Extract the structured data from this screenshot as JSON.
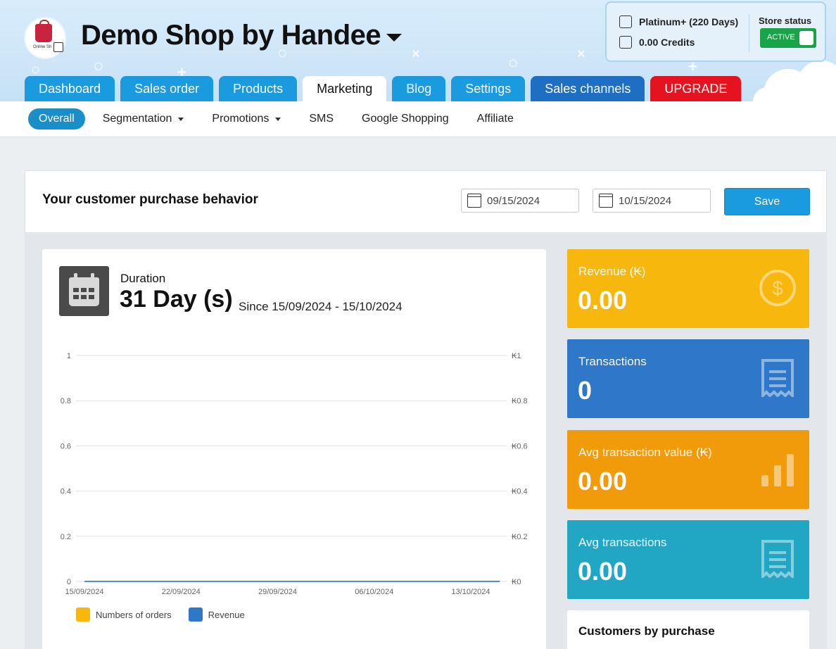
{
  "header": {
    "shop_name": "Demo Shop by Handee",
    "logo_text": "Online Sh",
    "plan_label": "Platinum+ (220 Days)",
    "credits_label": "0.00 Credits",
    "store_status_label": "Store status",
    "store_status_value": "ACTIVE",
    "status_color": "#19a44a"
  },
  "tabs": [
    {
      "label": "Dashboard",
      "active": false
    },
    {
      "label": "Sales order",
      "active": false
    },
    {
      "label": "Products",
      "active": false
    },
    {
      "label": "Marketing",
      "active": true
    },
    {
      "label": "Blog",
      "active": false
    },
    {
      "label": "Settings",
      "active": false
    },
    {
      "label": "Sales channels",
      "active": false
    },
    {
      "label": "UPGRADE",
      "active": false
    }
  ],
  "subnav": [
    {
      "label": "Overall",
      "active": true
    },
    {
      "label": "Segmentation",
      "dropdown": true
    },
    {
      "label": "Promotions",
      "dropdown": true
    },
    {
      "label": "SMS"
    },
    {
      "label": "Google Shopping"
    },
    {
      "label": "Affiliate"
    }
  ],
  "behavior": {
    "title": "Your customer purchase behavior",
    "start_date": "09/15/2024",
    "end_date": "10/15/2024",
    "save_label": "Save"
  },
  "duration": {
    "label": "Duration",
    "value": "31 Day (s)",
    "since": "Since 15/09/2024 - 15/10/2024"
  },
  "chart_data": {
    "type": "line",
    "x": [
      "15/09/2024",
      "22/09/2024",
      "29/09/2024",
      "06/10/2024",
      "13/10/2024"
    ],
    "y_left_ticks": [
      "0",
      "0.2",
      "0.4",
      "0.6",
      "0.8",
      "1"
    ],
    "y_right_ticks": [
      "₭0",
      "₭0.2",
      "₭0.4",
      "₭0.6",
      "₭0.8",
      "₭1"
    ],
    "ylim": [
      0,
      1
    ],
    "grid": true,
    "legend_position": "bottom-left",
    "series": [
      {
        "name": "Numbers of orders",
        "color": "#f8b70d",
        "values": [
          0,
          0,
          0,
          0,
          0
        ]
      },
      {
        "name": "Revenue",
        "color": "#2f78c9",
        "values": [
          0,
          0,
          0,
          0,
          0
        ]
      }
    ]
  },
  "stats": [
    {
      "label": "Revenue (₭)",
      "value": "0.00",
      "color": "#f8b70d",
      "icon": "dollar-coin-icon"
    },
    {
      "label": "Transactions",
      "value": "0",
      "color": "#2f78c9",
      "icon": "receipt-icon"
    },
    {
      "label": "Avg transaction value (₭)",
      "value": "0.00",
      "color": "#f19b0b",
      "icon": "bar-chart-icon"
    },
    {
      "label": "Avg transactions",
      "value": "0.00",
      "color": "#21a6c4",
      "icon": "receipt-icon"
    }
  ],
  "customers_card": {
    "title": "Customers by purchase"
  }
}
